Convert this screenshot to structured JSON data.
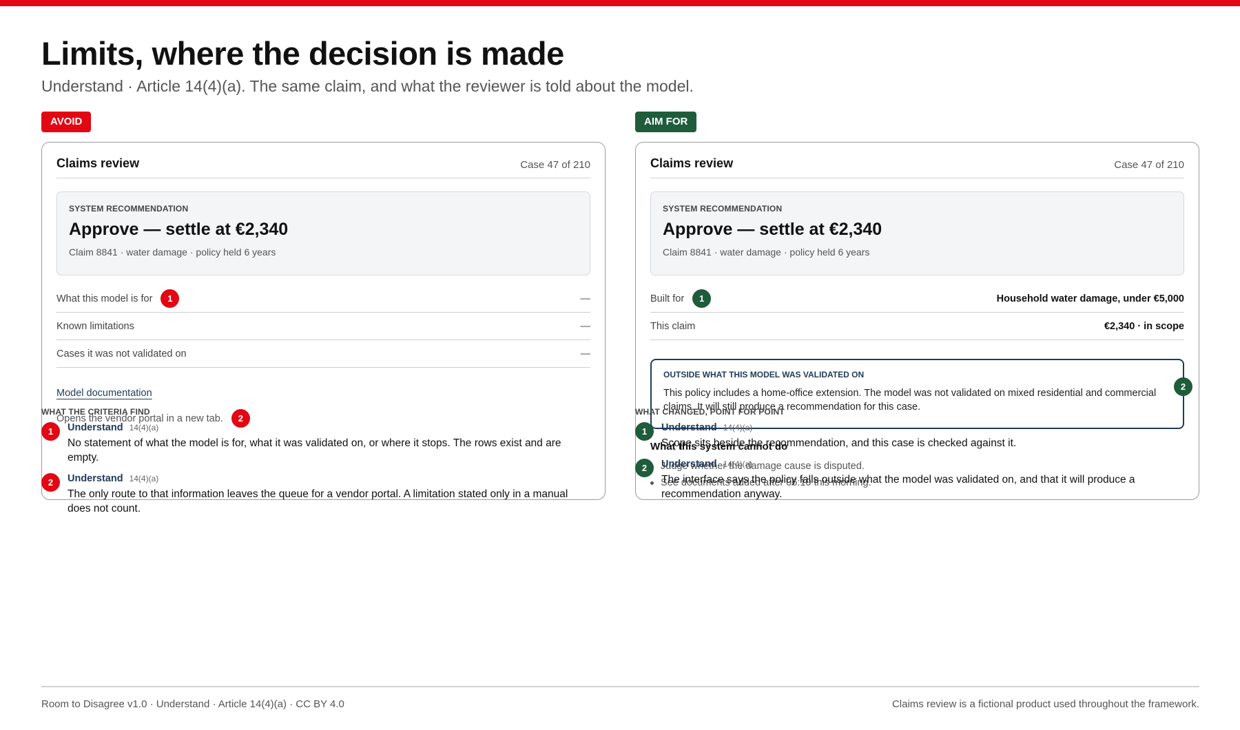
{
  "accent_red": "#e30613",
  "accent_green": "#1e5c3c",
  "title": "Limits, where the decision is made",
  "subtitle": "Understand · Article 14(4)(a). The same claim, and what the reviewer is told about the model.",
  "avoid": {
    "pill": "AVOID",
    "card": {
      "title": "Claims review",
      "case": "Case 47 of 210",
      "rec_label": "SYSTEM RECOMMENDATION",
      "rec_main": "Approve — settle at €2,340",
      "rec_sub": "Claim 8841 · water damage · policy held 6 years",
      "rows": [
        {
          "label": "What this model is for",
          "value": "—"
        },
        {
          "label": "Known limitations",
          "value": "—"
        },
        {
          "label": "Cases it was not validated on",
          "value": "—"
        }
      ],
      "doc_link": "Model documentation",
      "doc_note": "Opens the vendor portal in a new tab."
    },
    "section_label": "WHAT THE CRITERIA FIND",
    "findings": [
      {
        "num": "1",
        "tag": "Understand",
        "art": "14(4)(a)",
        "text": "No statement of what the model is for, what it was validated on, or where it stops. The rows exist and are empty."
      },
      {
        "num": "2",
        "tag": "Understand",
        "art": "14(4)(a)",
        "text": "The only route to that information leaves the queue for a vendor portal. A limitation stated only in a manual does not count."
      }
    ]
  },
  "aim": {
    "pill": "AIM FOR",
    "card": {
      "title": "Claims review",
      "case": "Case 47 of 210",
      "rec_label": "SYSTEM RECOMMENDATION",
      "rec_main": "Approve — settle at €2,340",
      "rec_sub": "Claim 8841 · water damage · policy held 6 years",
      "rows": [
        {
          "label": "Built for",
          "value": "Household water damage, under €5,000"
        },
        {
          "label": "This claim",
          "value": "€2,340 · in scope"
        }
      ],
      "scope_label": "OUTSIDE WHAT THIS MODEL WAS VALIDATED ON",
      "scope_text": "This policy includes a home-office extension. The model was not validated on mixed residential and commercial claims. It will still produce a recommendation for this case.",
      "cannot_title": "What this system cannot do",
      "cannot_items": [
        "Judge whether the damage cause is disputed.",
        "See documents added after 06:10 this morning."
      ]
    },
    "section_label": "WHAT CHANGED, POINT FOR POINT",
    "findings": [
      {
        "num": "1",
        "tag": "Understand",
        "art": "14(4)(a)",
        "text": "Scope sits beside the recommendation, and this case is checked against it."
      },
      {
        "num": "2",
        "tag": "Understand",
        "art": "14(4)(a)",
        "text": "The interface says the policy falls outside what the model was validated on, and that it will produce a recommendation anyway."
      }
    ]
  },
  "footer": {
    "left": "Room to Disagree v1.0 · Understand · Article 14(4)(a) · CC BY 4.0",
    "right": "Claims review is a fictional product used throughout the framework."
  }
}
